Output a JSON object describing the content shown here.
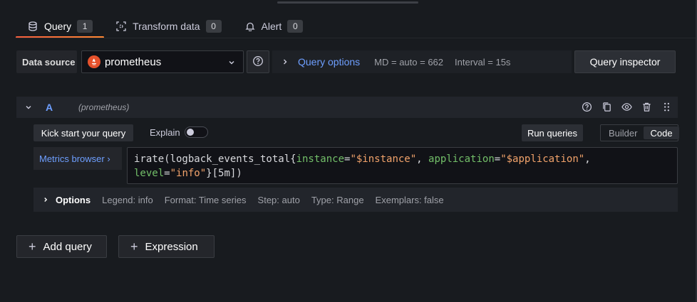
{
  "tabs": [
    {
      "label": "Query",
      "count": "1",
      "icon": "database-icon"
    },
    {
      "label": "Transform data",
      "count": "0",
      "icon": "transform-icon"
    },
    {
      "label": "Alert",
      "count": "0",
      "icon": "bell-icon"
    }
  ],
  "datasource": {
    "label": "Data source",
    "selected": "prometheus",
    "icon": "prometheus-icon"
  },
  "query_options": {
    "title": "Query options",
    "md": "MD = auto = 662",
    "interval": "Interval = 15s"
  },
  "query_inspector_label": "Query inspector",
  "query_row": {
    "ref_id": "A",
    "datasource_name": "(prometheus)",
    "kick_start_label": "Kick start your query",
    "explain_label": "Explain",
    "explain_enabled": false,
    "run_label": "Run queries",
    "modes": [
      "Builder",
      "Code"
    ],
    "active_mode": "Code",
    "metrics_browser_label": "Metrics browser ›",
    "query_line1": {
      "p1": "irate(logback_events_total{",
      "l1": "instance",
      "e1": "=",
      "s1": "\"$instance\"",
      "c1": ", ",
      "l2": "application",
      "e2": "=",
      "s2": "\"$application\"",
      "c2": ","
    },
    "query_line2": {
      "l3": "level",
      "e3": "=",
      "s3": "\"info\"",
      "p2": "}[5m])"
    },
    "options": {
      "title": "Options",
      "legend": "Legend: info",
      "format": "Format: Time series",
      "step": "Step: auto",
      "type": "Type: Range",
      "exemplars": "Exemplars: false"
    }
  },
  "add_query_label": "Add query",
  "expression_label": "Expression",
  "colors": {
    "accent_blue": "#6e9fff",
    "tab_underline": "#f55f3e",
    "label_green": "#73bf69",
    "string_orange": "#f2a36b"
  }
}
